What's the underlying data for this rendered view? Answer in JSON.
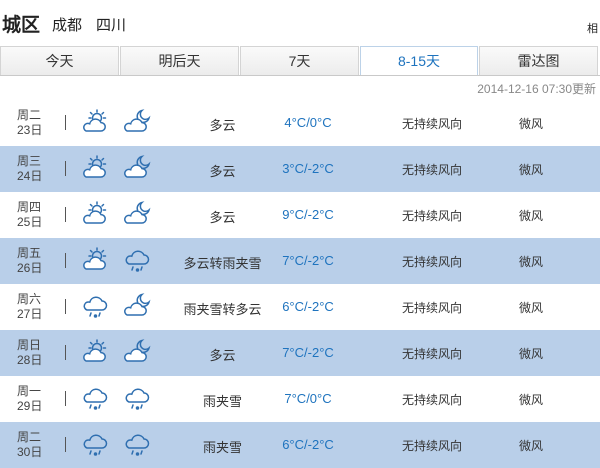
{
  "header": {
    "district": "城区",
    "city": "成都",
    "province": "四川",
    "related": "相"
  },
  "tabs": [
    {
      "label": "今天"
    },
    {
      "label": "明后天"
    },
    {
      "label": "7天"
    },
    {
      "label": "8-15天"
    },
    {
      "label": "雷达图"
    }
  ],
  "active_tab": "8-15天",
  "updated": "2014-12-16 07:30更新",
  "forecast": [
    {
      "weekday": "周二",
      "date": "23日",
      "day_icon": "partly-cloudy-sun-icon",
      "night_icon": "partly-cloudy-moon-icon",
      "weather": "多云",
      "temp": "4°C/0°C",
      "wind": "无持续风向",
      "force": "微风"
    },
    {
      "weekday": "周三",
      "date": "24日",
      "day_icon": "partly-cloudy-sun-icon",
      "night_icon": "partly-cloudy-moon-icon",
      "weather": "多云",
      "temp": "3°C/-2°C",
      "wind": "无持续风向",
      "force": "微风"
    },
    {
      "weekday": "周四",
      "date": "25日",
      "day_icon": "partly-cloudy-sun-icon",
      "night_icon": "partly-cloudy-moon-icon",
      "weather": "多云",
      "temp": "9°C/-2°C",
      "wind": "无持续风向",
      "force": "微风"
    },
    {
      "weekday": "周五",
      "date": "26日",
      "day_icon": "partly-cloudy-sun-icon",
      "night_icon": "sleet-icon",
      "weather": "多云转雨夹雪",
      "temp": "7°C/-2°C",
      "wind": "无持续风向",
      "force": "微风"
    },
    {
      "weekday": "周六",
      "date": "27日",
      "day_icon": "sleet-icon",
      "night_icon": "partly-cloudy-moon-icon",
      "weather": "雨夹雪转多云",
      "temp": "6°C/-2°C",
      "wind": "无持续风向",
      "force": "微风"
    },
    {
      "weekday": "周日",
      "date": "28日",
      "day_icon": "partly-cloudy-sun-icon",
      "night_icon": "partly-cloudy-moon-icon",
      "weather": "多云",
      "temp": "7°C/-2°C",
      "wind": "无持续风向",
      "force": "微风"
    },
    {
      "weekday": "周一",
      "date": "29日",
      "day_icon": "sleet-icon",
      "night_icon": "sleet-icon",
      "weather": "雨夹雪",
      "temp": "7°C/0°C",
      "wind": "无持续风向",
      "force": "微风"
    },
    {
      "weekday": "周二",
      "date": "30日",
      "day_icon": "sleet-icon",
      "night_icon": "sleet-icon",
      "weather": "雨夹雪",
      "temp": "6°C/-2°C",
      "wind": "无持续风向",
      "force": "微风"
    }
  ]
}
